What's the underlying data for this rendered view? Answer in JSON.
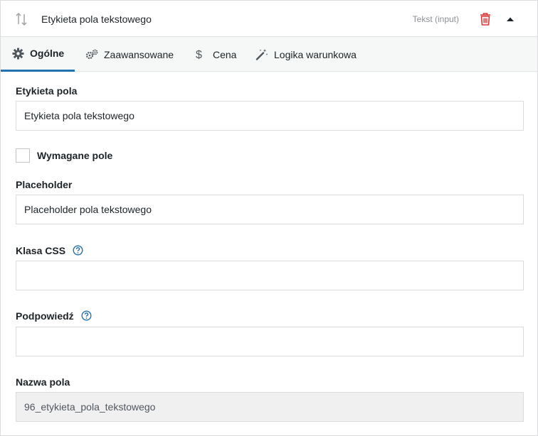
{
  "header": {
    "title": "Etykieta pola tekstowego",
    "type_label": "Tekst (input)",
    "icons": {
      "drag": "sort-arrows-icon",
      "delete": "trash-icon",
      "collapse": "caret-up-icon"
    },
    "colors": {
      "delete": "#d63638"
    }
  },
  "tabs": [
    {
      "label": "Ogólne",
      "icon": "gear-icon",
      "active": true
    },
    {
      "label": "Zaawansowane",
      "icon": "gears-icon",
      "active": false
    },
    {
      "label": "Cena",
      "icon": "dollar-icon",
      "active": false
    },
    {
      "label": "Logika warunkowa",
      "icon": "magic-wand-icon",
      "active": false
    }
  ],
  "form": {
    "field_label": {
      "label": "Etykieta pola",
      "value": "Etykieta pola tekstowego"
    },
    "required": {
      "label": "Wymagane pole",
      "checked": false
    },
    "placeholder": {
      "label": "Placeholder",
      "value": "Placeholder pola tekstowego"
    },
    "css_class": {
      "label": "Klasa CSS",
      "value": ""
    },
    "hint": {
      "label": "Podpowiedź",
      "value": ""
    },
    "field_name": {
      "label": "Nazwa pola",
      "value": "96_etykieta_pola_tekstowego"
    }
  },
  "accent_color": "#2271b1"
}
